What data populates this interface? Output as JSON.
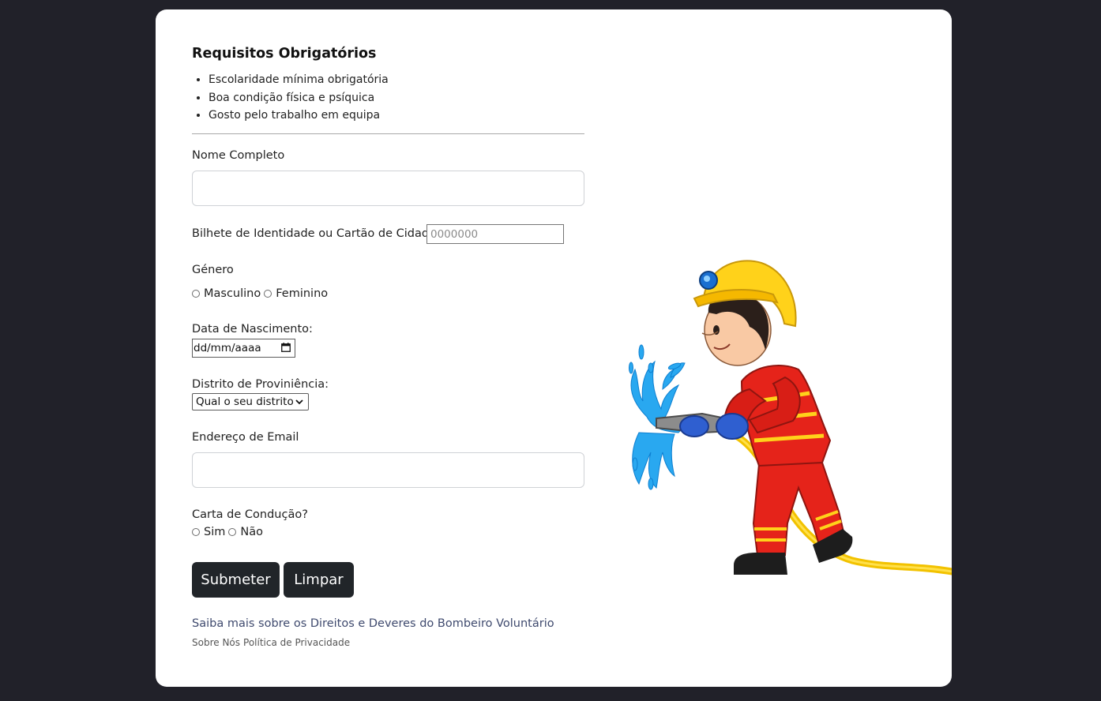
{
  "requirements": {
    "title": "Requisitos Obrigatórios",
    "items": [
      "Escolaridade mínima obrigatória",
      "Boa condição física e psíquica",
      "Gosto pelo trabalho em equipa"
    ]
  },
  "form": {
    "full_name_label": "Nome Completo",
    "full_name_value": "",
    "id_label": "Bilhete de Identidade ou Cartão de Cidadão:",
    "id_placeholder": "0000000",
    "gender_label": "Género",
    "gender_options": [
      "Masculino",
      "Feminino"
    ],
    "birthdate_label": "Data de Nascimento:",
    "birthdate_placeholder": "dd/mm/aaaa",
    "district_label": "Distrito de Proviniência:",
    "district_selected": "Qual o seu distrito",
    "email_label": "Endereço de Email",
    "email_value": "",
    "license_label": "Carta de Condução?",
    "license_options": [
      "Sim",
      "Não"
    ]
  },
  "buttons": {
    "submit": "Submeter",
    "clear": "Limpar"
  },
  "links": {
    "rights": "Saiba mais sobre os Direitos e Deveres do Bombeiro Voluntário",
    "about": "Sobre Nós",
    "privacy": "Política de Privacidade"
  },
  "colors": {
    "page_background": "#212129",
    "card_background": "#ffffff",
    "button_background": "#212529",
    "link_color": "#3f4a6e"
  },
  "illustration": {
    "icon": "firefighter-illustration"
  }
}
